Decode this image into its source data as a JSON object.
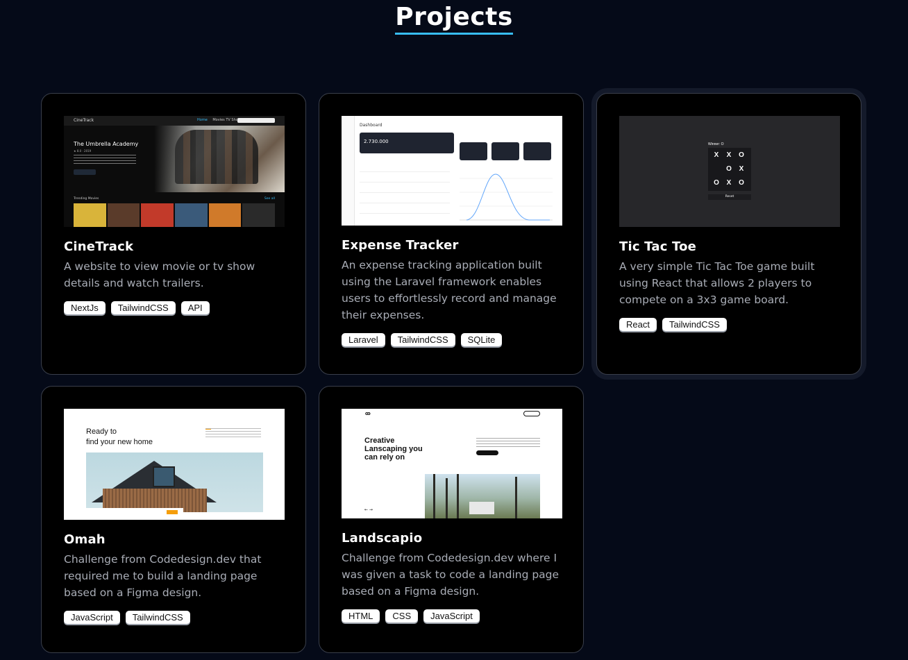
{
  "page": {
    "title": "Projects",
    "accent_color": "#38bdf8",
    "background": "#050a18"
  },
  "projects": [
    {
      "title": "CineTrack",
      "description": "A website to view movie or tv show details and watch trailers.",
      "tags": [
        "NextJs",
        "TailwindCSS",
        "API"
      ],
      "preview": {
        "logo": "CineTrack",
        "nav": [
          "Home",
          "Movies",
          "TV Shows"
        ],
        "show_title": "The Umbrella Academy",
        "meta": "★ 8.0 · 2019",
        "section": "Trending Movies",
        "see_all": "See all",
        "poster_colors": [
          "#d9b43a",
          "#5a3b2a",
          "#c23a2a",
          "#3a5a7a",
          "#d07a2a",
          "#2a2a2a"
        ]
      }
    },
    {
      "title": "Expense Tracker",
      "description": "An expense tracking application built using the Laravel framework enables users to effortlessly record and manage their expenses.",
      "tags": [
        "Laravel",
        "TailwindCSS",
        "SQLite"
      ],
      "preview": {
        "heading": "Dashboard",
        "balance": "2.730.000"
      }
    },
    {
      "title": "Tic Tac Toe",
      "description": "A very simple Tic Tac Toe game built using React that allows 2 players to compete on a 3x3 game board.",
      "tags": [
        "React",
        "TailwindCSS"
      ],
      "active": true,
      "preview": {
        "winner": "Winner: O",
        "cells": [
          "X",
          "X",
          "O",
          "",
          "O",
          "X",
          "O",
          "X",
          "O"
        ],
        "reset": "Reset"
      }
    },
    {
      "title": "Omah",
      "description": "Challenge from Codedesign.dev that required me to build a landing page based on a Figma design.",
      "tags": [
        "JavaScript",
        "TailwindCSS"
      ],
      "preview": {
        "heading_line1": "Ready to",
        "heading_line2": "find your new home"
      }
    },
    {
      "title": "Landscapio",
      "description": "Challenge from Codedesign.dev where I was given a task to code a landing page based on a Figma design.",
      "tags": [
        "HTML",
        "CSS",
        "JavaScript"
      ],
      "preview": {
        "logo": "ꝏ",
        "heading_line1": "Creative",
        "heading_line2": "Lanscaping you",
        "heading_line3": "can rely on",
        "arrows": "← →"
      }
    }
  ]
}
